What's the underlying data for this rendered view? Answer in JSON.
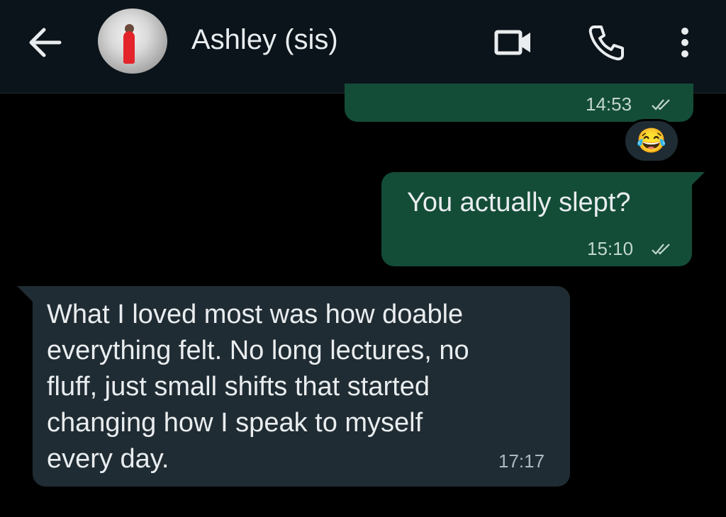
{
  "header": {
    "contact_name": "Ashley (sis)",
    "back_icon": "arrow-left-icon",
    "video_icon": "video-camera-icon",
    "phone_icon": "phone-icon",
    "more_icon": "more-vertical-icon",
    "background": "#0b141a"
  },
  "messages": [
    {
      "direction": "outgoing",
      "text": "",
      "time": "14:53",
      "status": "read",
      "reaction": "😂"
    },
    {
      "direction": "outgoing",
      "text": "You actually slept?",
      "time": "15:10",
      "status": "read"
    },
    {
      "direction": "incoming",
      "lines": [
        "What I loved most was how doable",
        "everything felt. No long lectures, no",
        "fluff, just small shifts that started",
        "changing how I speak to myself",
        "every day."
      ],
      "time": "17:17"
    }
  ],
  "colors": {
    "outgoing_bubble": "#144d37",
    "incoming_bubble": "#202c33",
    "chat_background": "#000000"
  }
}
